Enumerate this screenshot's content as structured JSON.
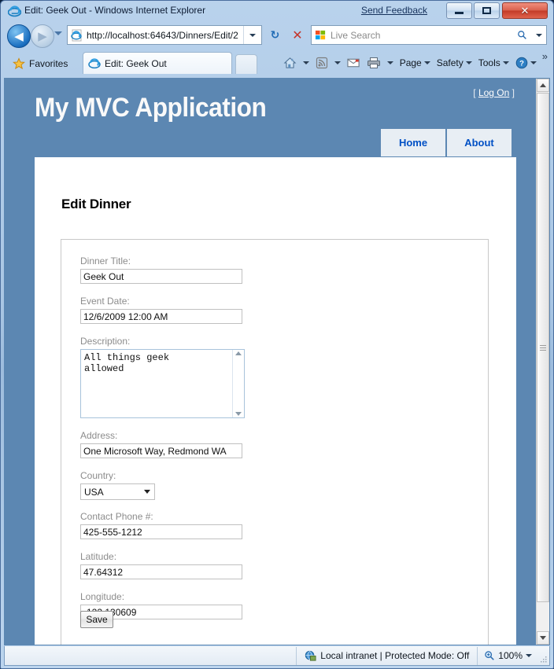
{
  "window": {
    "title": "Edit: Geek Out - Windows Internet Explorer",
    "send_feedback": "Send Feedback",
    "minimize_label": "Minimize",
    "maximize_label": "Maximize",
    "close_label": "Close",
    "close_glyph": "✕"
  },
  "navigation": {
    "back_glyph": "◀",
    "forward_glyph": "▶",
    "refresh_glyph": "↻",
    "stop_glyph": "✕",
    "address_url": "http://localhost:64643/Dinners/Edit/2",
    "search_placeholder": "Live Search",
    "search_go_glyph": "🔍"
  },
  "tabs": {
    "favorites_label": "Favorites",
    "active_tab_title": "Edit: Geek Out"
  },
  "command_bar": {
    "items": [
      {
        "name": "home",
        "label": ""
      },
      {
        "name": "feeds",
        "label": ""
      },
      {
        "name": "mail",
        "label": ""
      },
      {
        "name": "print",
        "label": ""
      },
      {
        "name": "page",
        "label": "Page"
      },
      {
        "name": "safety",
        "label": "Safety"
      },
      {
        "name": "tools",
        "label": "Tools"
      },
      {
        "name": "help",
        "label": ""
      }
    ],
    "overflow_glyph": "»"
  },
  "site": {
    "title": "My MVC Application",
    "logon_prefix": "[",
    "logon_label": "Log On",
    "logon_suffix": "]",
    "nav": [
      {
        "label": "Home"
      },
      {
        "label": "About"
      }
    ],
    "header_color": "#5c87b2",
    "tab_bg_color": "#e8eef4",
    "tab_text_color": "#0050c5"
  },
  "page": {
    "heading": "Edit Dinner",
    "fields": [
      {
        "label": "Dinner Title:",
        "value": "Geek Out"
      },
      {
        "label": "Event Date:",
        "value": "12/6/2009 12:00 AM"
      },
      {
        "label": "Description:",
        "value": "All things geek\nallowed"
      },
      {
        "label": "Address:",
        "value": "One Microsoft Way, Redmond WA"
      },
      {
        "label": "Country:",
        "value": "USA"
      },
      {
        "label": "Contact Phone #:",
        "value": "425-555-1212"
      },
      {
        "label": "Latitude:",
        "value": "47.64312"
      },
      {
        "label": "Longitude:",
        "value": "-122.130609"
      }
    ],
    "save_label": "Save"
  },
  "status_bar": {
    "zone_text": "Local intranet | Protected Mode: Off",
    "zoom_level": "100%"
  }
}
